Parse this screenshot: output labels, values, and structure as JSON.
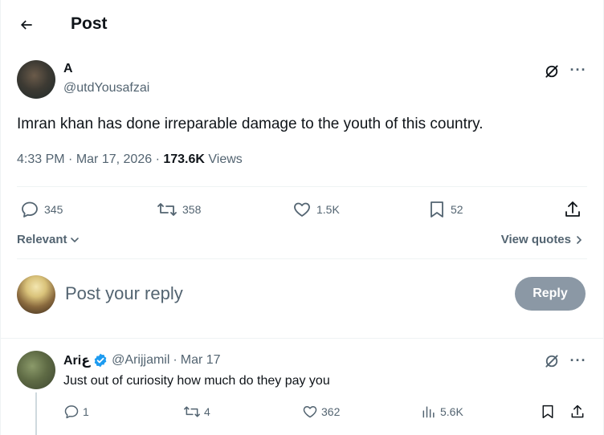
{
  "header": {
    "title": "Post"
  },
  "post": {
    "author_name": "A",
    "author_handle": "@utdYousafzai",
    "text": "Imran khan has done irreparable damage to the youth of this country.",
    "time": "4:33 PM",
    "date": "Mar 17, 2026",
    "views_count": "173.6K",
    "views_label": "Views",
    "replies": "345",
    "reposts": "358",
    "likes": "1.5K",
    "bookmarks": "52"
  },
  "sort": {
    "label": "Relevant"
  },
  "view_quotes": {
    "label": "View quotes"
  },
  "reply_box": {
    "placeholder": "Post your reply",
    "button_label": "Reply"
  },
  "reply": {
    "author_name": "Ariع",
    "author_handle": "@Arijjamil",
    "date": "Mar 17",
    "text": "Just out of curiosity how much do they pay you",
    "replies": "1",
    "reposts": "4",
    "likes": "362",
    "views": "5.6K"
  },
  "colors": {
    "secondary_text": "#536471",
    "verified_blue": "#1d9bf0",
    "reply_button_bg": "#8b98a5"
  },
  "icons": [
    "back-arrow-icon",
    "grok-icon",
    "more-icon",
    "reply-icon",
    "repost-icon",
    "like-icon",
    "bookmark-icon",
    "share-icon",
    "views-icon",
    "verified-badge-icon",
    "chevron-down-icon",
    "chevron-right-icon"
  ]
}
